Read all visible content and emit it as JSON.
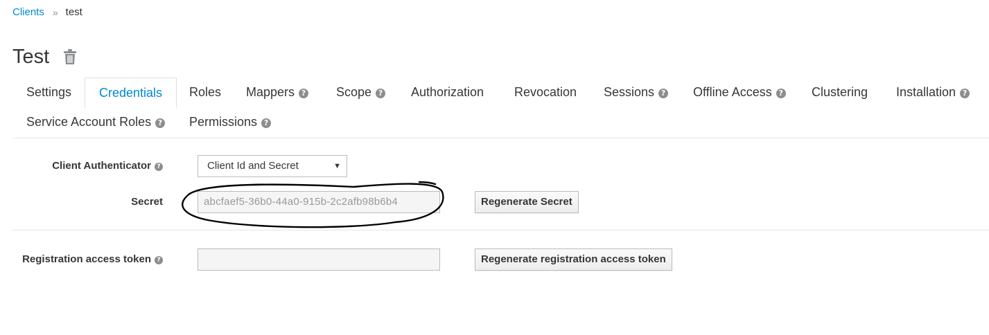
{
  "breadcrumb": {
    "root": "Clients",
    "separator": "»",
    "current": "test"
  },
  "page": {
    "title": "Test",
    "delete_icon": "trash-icon"
  },
  "tabs": [
    {
      "label": "Settings",
      "help": false
    },
    {
      "label": "Credentials",
      "help": false,
      "active": true
    },
    {
      "label": "Roles",
      "help": false
    },
    {
      "label": "Mappers",
      "help": true
    },
    {
      "label": "Scope",
      "help": true
    },
    {
      "label": "Authorization",
      "help": false
    },
    {
      "label": "Revocation",
      "help": false
    },
    {
      "label": "Sessions",
      "help": true
    },
    {
      "label": "Offline Access",
      "help": true
    },
    {
      "label": "Clustering",
      "help": false
    },
    {
      "label": "Installation",
      "help": true
    },
    {
      "label": "Service Account Roles",
      "help": true
    },
    {
      "label": "Permissions",
      "help": true
    }
  ],
  "help_glyph": "?",
  "form": {
    "client_authenticator": {
      "label": "Client Authenticator",
      "value": "Client Id and Secret"
    },
    "secret": {
      "label": "Secret",
      "value": "abcfaef5-36b0-44a0-915b-2c2afb98b6b4",
      "button": "Regenerate Secret"
    },
    "registration_token": {
      "label": "Registration access token",
      "value": "",
      "button": "Regenerate registration access token"
    }
  },
  "colors": {
    "link": "#0088ce",
    "active_tab": "#0088ce",
    "annotation": "#000000"
  }
}
